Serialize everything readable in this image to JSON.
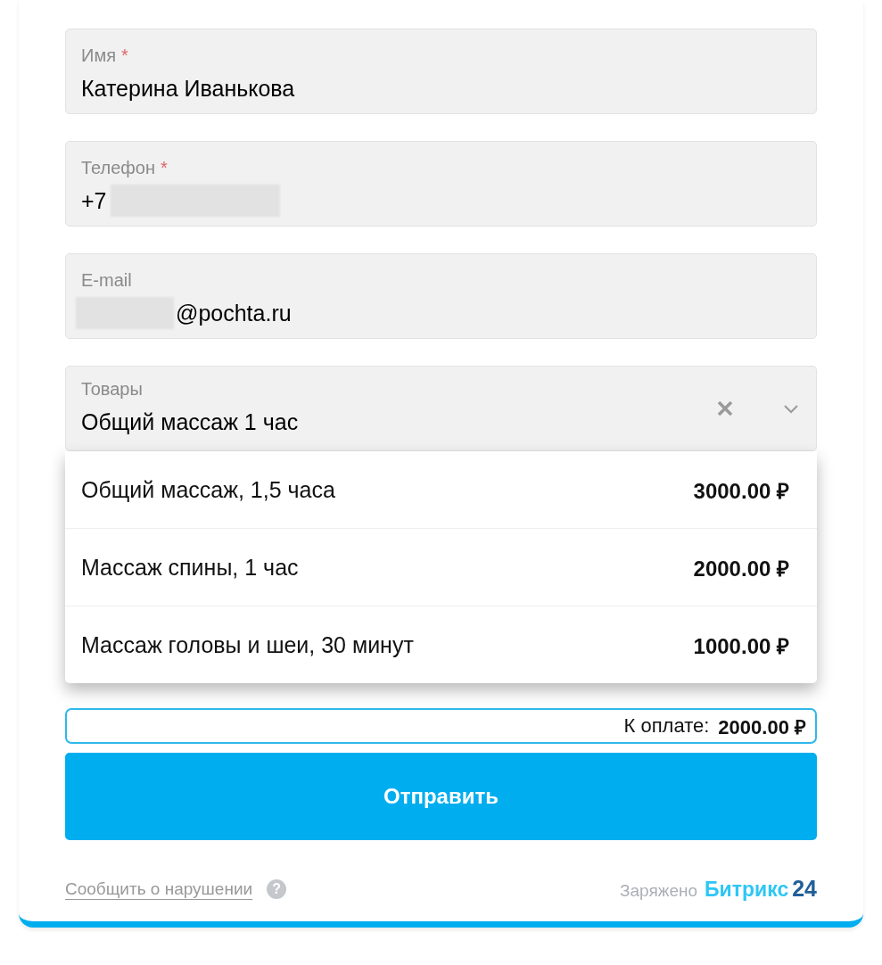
{
  "fields": [
    {
      "label": "Имя",
      "required_mark": "*",
      "value_parts": [
        {
          "kind": "text",
          "text": "Катерина Иванькова"
        }
      ]
    },
    {
      "label": "Телефон",
      "required_mark": "*",
      "value_parts": [
        {
          "kind": "text",
          "text": "+7"
        },
        {
          "kind": "redacted"
        }
      ]
    },
    {
      "label": "E-mail",
      "value_parts": [
        {
          "kind": "redacted"
        },
        {
          "kind": "text",
          "text": "@pochta.ru"
        }
      ]
    }
  ],
  "products": {
    "label": "Товары",
    "value": "Общий массаж 1 час",
    "expanded": true,
    "options": [
      {
        "name": "Общий массаж, 1,5 часа",
        "price": "3000.00 ₽",
        "selected": false
      },
      {
        "name": "Массаж спины, 1 час",
        "price": "2000.00 ₽",
        "selected": false
      },
      {
        "name": "Массаж головы и шеи, 30 минут",
        "price": "1000.00 ₽",
        "selected": false
      }
    ]
  },
  "total": {
    "label": "К оплате:",
    "amount": "2000.00 ₽"
  },
  "submit": "Отправить",
  "footer": {
    "report_link": "Сообщить о нарушении",
    "help": "?",
    "powered": "Заряжено",
    "brand": "Битрикс",
    "brand_number": "24"
  }
}
